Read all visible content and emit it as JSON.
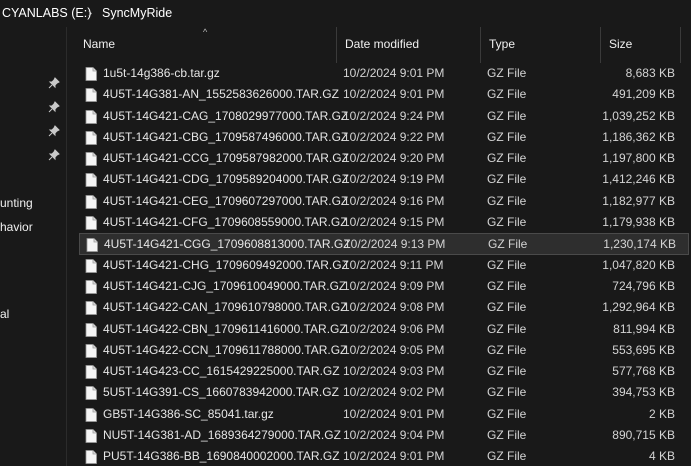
{
  "breadcrumb": {
    "drive": "CYANLABS (E:)",
    "separator": "›",
    "folder": "SyncMyRide"
  },
  "nav": {
    "pins": [
      "pin-icon",
      "pin-icon",
      "pin-icon",
      "pin-icon"
    ],
    "items": [
      "unting",
      "havior",
      "al"
    ]
  },
  "columns": {
    "name": "Name",
    "date": "Date modified",
    "type": "Type",
    "size": "Size"
  },
  "files": [
    {
      "name": "1u5t-14g386-cb.tar.gz",
      "date": "10/2/2024 9:01 PM",
      "type": "GZ File",
      "size": "8,683 KB"
    },
    {
      "name": "4U5T-14G381-AN_1552583626000.TAR.GZ",
      "date": "10/2/2024 9:01 PM",
      "type": "GZ File",
      "size": "491,209 KB"
    },
    {
      "name": "4U5T-14G421-CAG_1708029977000.TAR.GZ",
      "date": "10/2/2024 9:24 PM",
      "type": "GZ File",
      "size": "1,039,252 KB"
    },
    {
      "name": "4U5T-14G421-CBG_1709587496000.TAR.GZ",
      "date": "10/2/2024 9:22 PM",
      "type": "GZ File",
      "size": "1,186,362 KB"
    },
    {
      "name": "4U5T-14G421-CCG_1709587982000.TAR.GZ",
      "date": "10/2/2024 9:20 PM",
      "type": "GZ File",
      "size": "1,197,800 KB"
    },
    {
      "name": "4U5T-14G421-CDG_1709589204000.TAR.GZ",
      "date": "10/2/2024 9:19 PM",
      "type": "GZ File",
      "size": "1,412,246 KB"
    },
    {
      "name": "4U5T-14G421-CEG_1709607297000.TAR.GZ",
      "date": "10/2/2024 9:16 PM",
      "type": "GZ File",
      "size": "1,182,977 KB"
    },
    {
      "name": "4U5T-14G421-CFG_1709608559000.TAR.GZ",
      "date": "10/2/2024 9:15 PM",
      "type": "GZ File",
      "size": "1,179,938 KB"
    },
    {
      "name": "4U5T-14G421-CGG_1709608813000.TAR.GZ",
      "date": "10/2/2024 9:13 PM",
      "type": "GZ File",
      "size": "1,230,174 KB",
      "selected": true
    },
    {
      "name": "4U5T-14G421-CHG_1709609492000.TAR.GZ",
      "date": "10/2/2024 9:11 PM",
      "type": "GZ File",
      "size": "1,047,820 KB"
    },
    {
      "name": "4U5T-14G421-CJG_1709610049000.TAR.GZ",
      "date": "10/2/2024 9:09 PM",
      "type": "GZ File",
      "size": "724,796 KB"
    },
    {
      "name": "4U5T-14G422-CAN_1709610798000.TAR.GZ",
      "date": "10/2/2024 9:08 PM",
      "type": "GZ File",
      "size": "1,292,964 KB"
    },
    {
      "name": "4U5T-14G422-CBN_1709611416000.TAR.GZ",
      "date": "10/2/2024 9:06 PM",
      "type": "GZ File",
      "size": "811,994 KB"
    },
    {
      "name": "4U5T-14G422-CCN_1709611788000.TAR.GZ",
      "date": "10/2/2024 9:05 PM",
      "type": "GZ File",
      "size": "553,695 KB"
    },
    {
      "name": "4U5T-14G423-CC_1615429225000.TAR.GZ",
      "date": "10/2/2024 9:03 PM",
      "type": "GZ File",
      "size": "577,768 KB"
    },
    {
      "name": "5U5T-14G391-CS_1660783942000.TAR.GZ",
      "date": "10/2/2024 9:02 PM",
      "type": "GZ File",
      "size": "394,753 KB"
    },
    {
      "name": "GB5T-14G386-SC_85041.tar.gz",
      "date": "10/2/2024 9:01 PM",
      "type": "GZ File",
      "size": "2 KB"
    },
    {
      "name": "NU5T-14G381-AD_1689364279000.TAR.GZ",
      "date": "10/2/2024 9:04 PM",
      "type": "GZ File",
      "size": "890,715 KB"
    },
    {
      "name": "PU5T-14G386-BB_1690840002000.TAR.GZ",
      "date": "10/2/2024 9:01 PM",
      "type": "GZ File",
      "size": "4 KB"
    }
  ],
  "colors": {
    "background": "#191919",
    "selected_row": "#2e2e2e",
    "text": "#e6e6e6"
  }
}
